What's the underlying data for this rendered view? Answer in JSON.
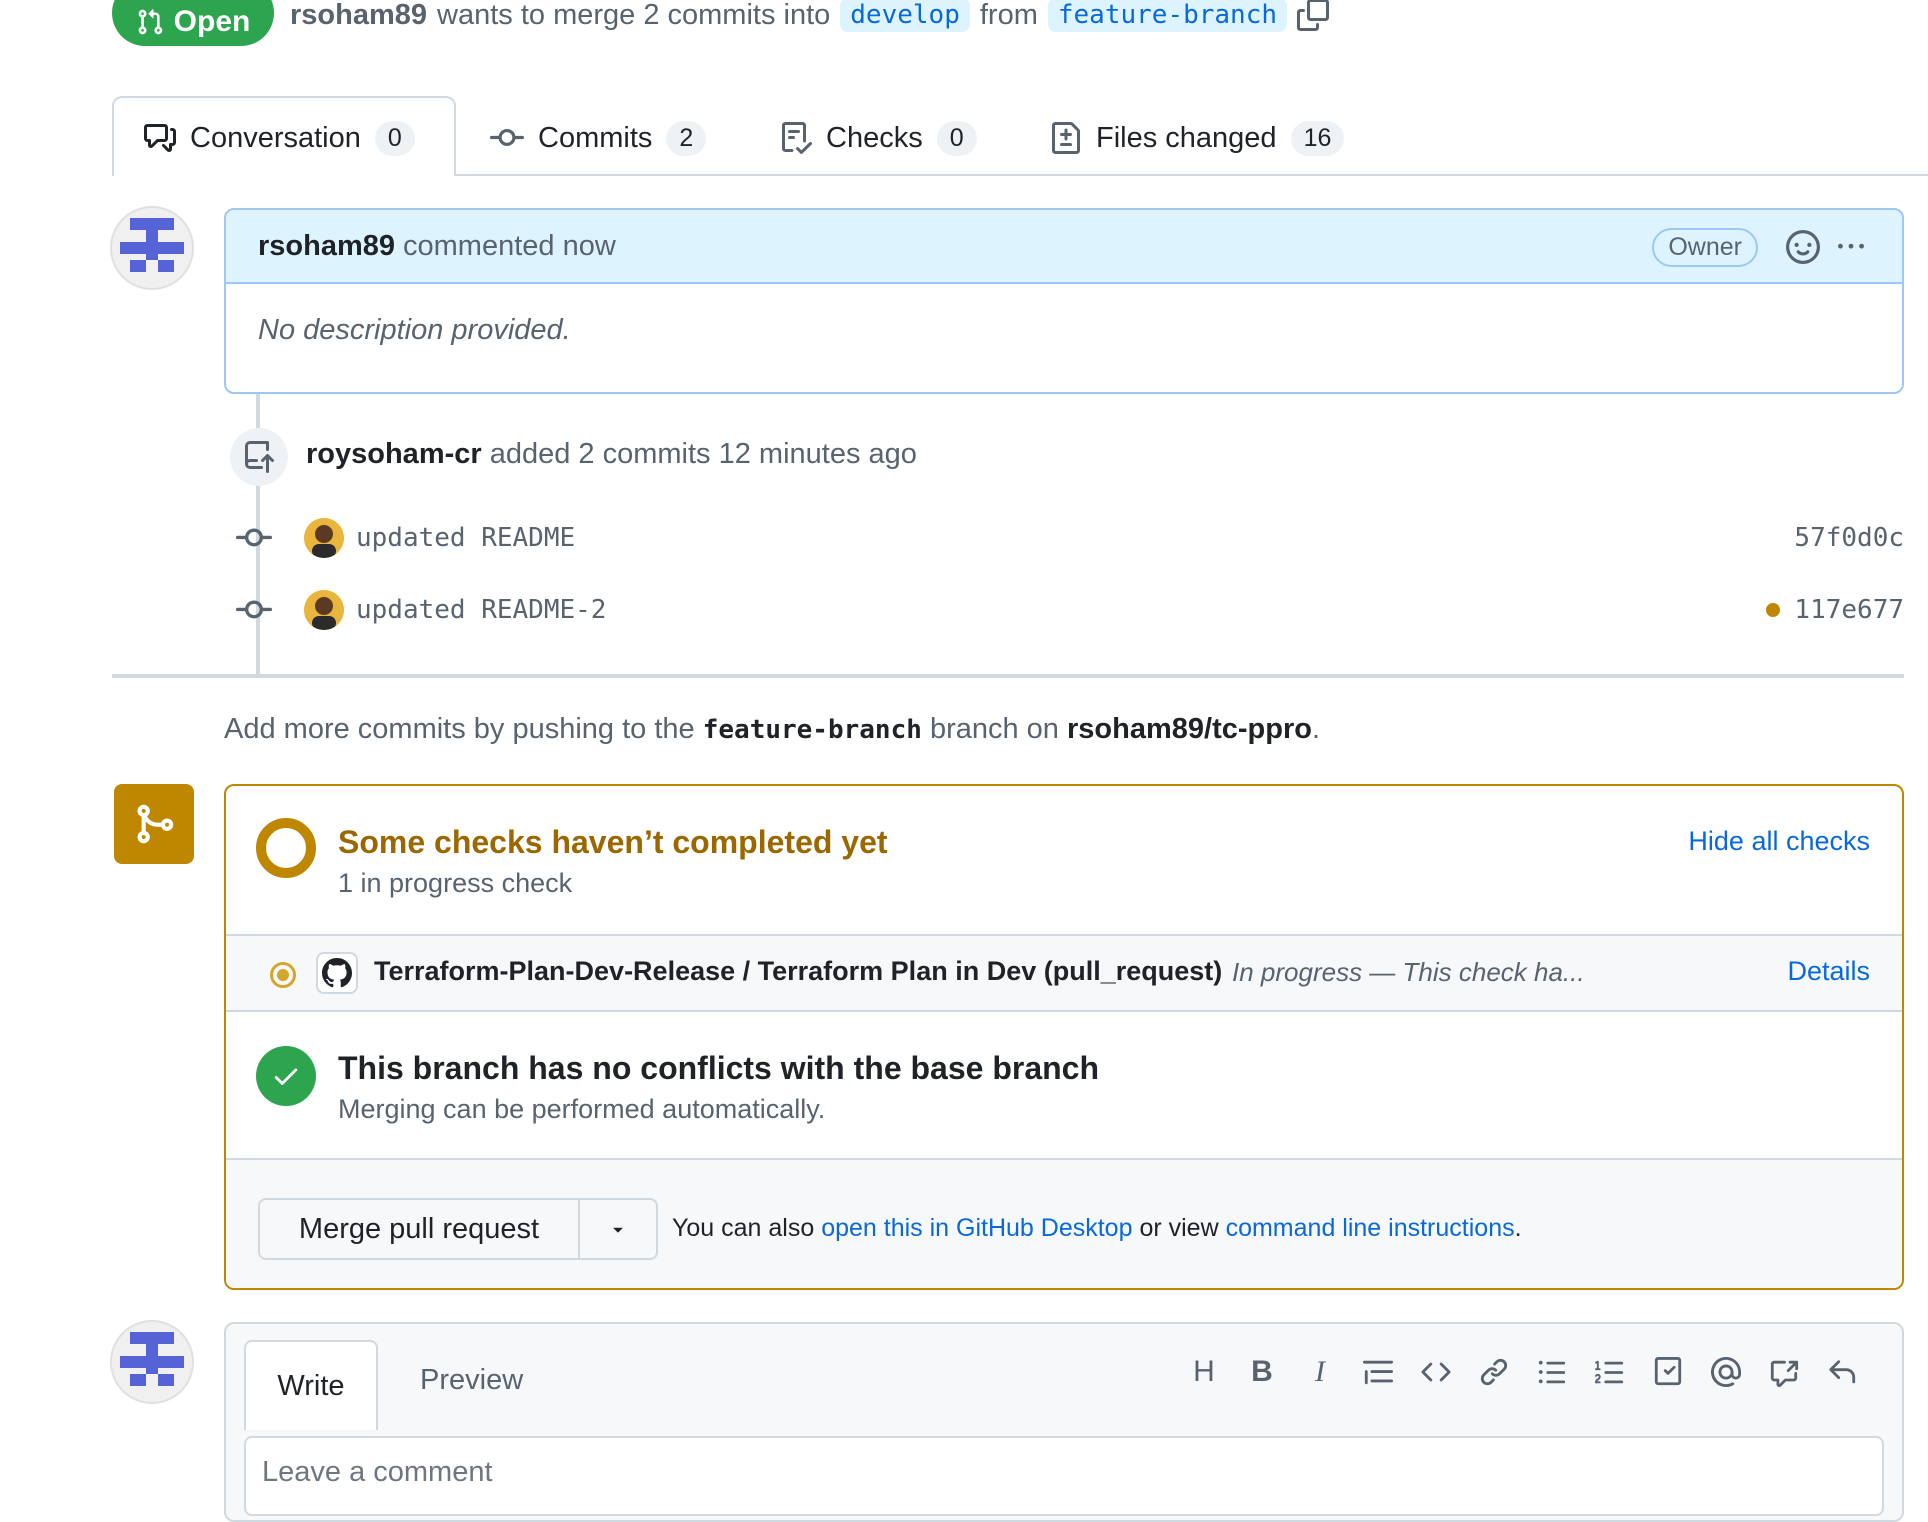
{
  "pr_header": {
    "state_label": "Open",
    "author": "rsoham89",
    "merge_text": "wants to merge 2 commits into",
    "base_branch": "develop",
    "from_text": "from",
    "head_branch": "feature-branch"
  },
  "tabs": [
    {
      "label": "Conversation",
      "count": "0",
      "icon": "comment-discussion-icon"
    },
    {
      "label": "Commits",
      "count": "2",
      "icon": "git-commit-icon"
    },
    {
      "label": "Checks",
      "count": "0",
      "icon": "checklist-icon"
    },
    {
      "label": "Files changed",
      "count": "16",
      "icon": "file-diff-icon"
    }
  ],
  "comment": {
    "author": "rsoham89",
    "action": "commented now",
    "role_badge": "Owner",
    "body": "No description provided."
  },
  "timeline": {
    "push_actor": "roysoham-cr",
    "push_text": "added 2 commits 12 minutes ago",
    "commits": [
      {
        "message": "updated README",
        "sha": "57f0d0c",
        "status_dot": false
      },
      {
        "message": "updated README-2",
        "sha": "117e677",
        "status_dot": true
      }
    ]
  },
  "hint": {
    "prefix": "Add more commits by pushing to the",
    "branch": "feature-branch",
    "middle": "branch on",
    "repo": "rsoham89/tc-ppro",
    "suffix": "."
  },
  "merge_box": {
    "checks_title": "Some checks haven’t completed yet",
    "checks_sub": "1 in progress check",
    "hide_checks": "Hide all checks",
    "check_name": "Terraform-Plan-Dev-Release / Terraform Plan in Dev (pull_request)",
    "check_status": "In progress — This check ha...",
    "details": "Details",
    "conflict_title": "This branch has no conflicts with the base branch",
    "conflict_sub": "Merging can be performed automatically.",
    "merge_button": "Merge pull request",
    "also_prefix": "You can also",
    "desktop_link": "open this in GitHub Desktop",
    "or_view": "or view",
    "cli_link": "command line instructions",
    "suffix": "."
  },
  "write": {
    "write_tab": "Write",
    "preview_tab": "Preview",
    "placeholder": "Leave a comment"
  },
  "colors": {
    "open_green": "#2da44e",
    "warning": "#bf8700",
    "link_blue": "#0969da",
    "success": "#2da44e"
  }
}
